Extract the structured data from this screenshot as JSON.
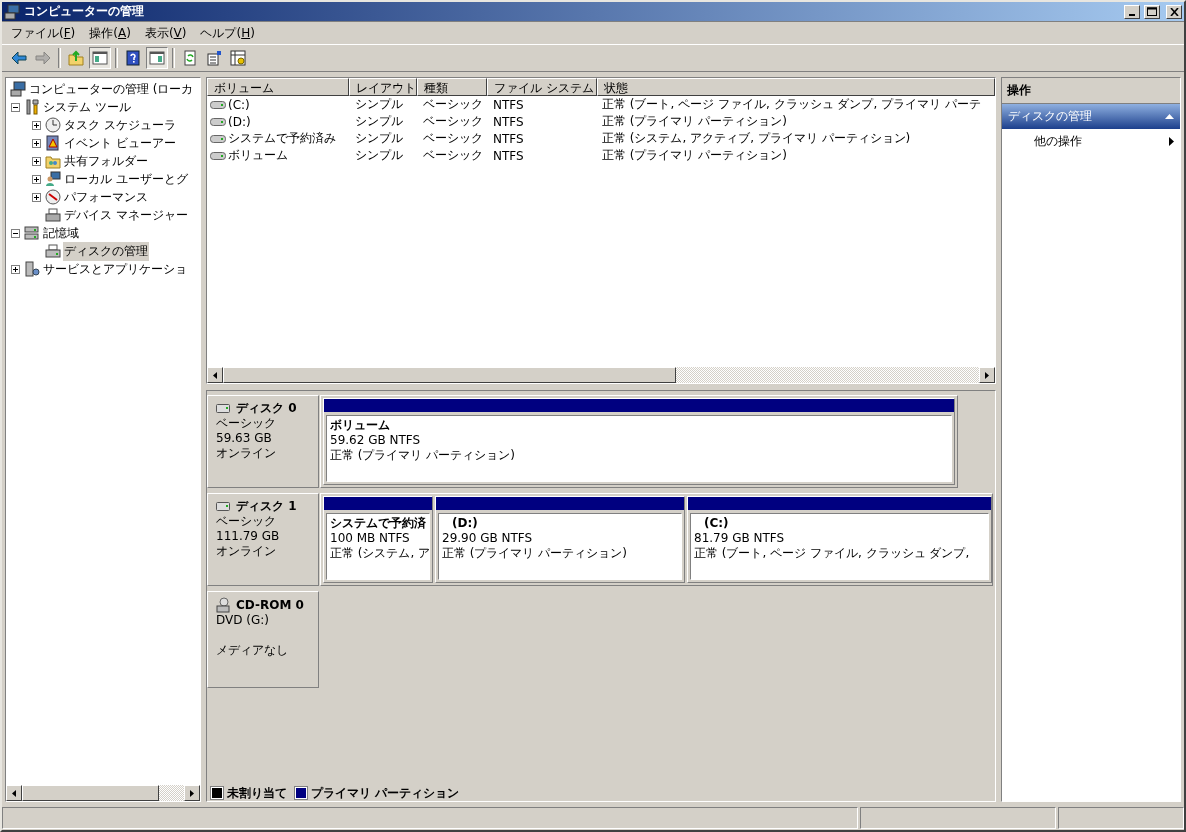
{
  "window": {
    "title": "コンピューターの管理"
  },
  "menu": [
    {
      "label": "ファイル(F)"
    },
    {
      "label": "操作(A)"
    },
    {
      "label": "表示(V)"
    },
    {
      "label": "ヘルプ(H)"
    }
  ],
  "toolbar": [
    {
      "kind": "back",
      "pressed": false,
      "disabled": false
    },
    {
      "kind": "forward",
      "pressed": false,
      "disabled": true
    },
    {
      "kind": "separator"
    },
    {
      "kind": "up",
      "pressed": false,
      "disabled": false
    },
    {
      "kind": "tree-pane",
      "pressed": true,
      "disabled": false
    },
    {
      "kind": "separator"
    },
    {
      "kind": "help",
      "pressed": false,
      "disabled": false
    },
    {
      "kind": "action-pane",
      "pressed": true,
      "disabled": false
    },
    {
      "kind": "separator"
    },
    {
      "kind": "refresh",
      "pressed": false,
      "disabled": false
    },
    {
      "kind": "properties",
      "pressed": false,
      "disabled": false
    },
    {
      "kind": "settings",
      "pressed": false,
      "disabled": false
    }
  ],
  "tree": {
    "label": "コンピューターの管理 (ローカ",
    "selected": false,
    "children": [
      {
        "label": "システム ツール",
        "expanded": true,
        "selected": false,
        "children": [
          {
            "label": "タスク スケジューラ",
            "expanded": false,
            "selected": false
          },
          {
            "label": "イベント ビューアー",
            "expanded": false,
            "selected": false
          },
          {
            "label": "共有フォルダー",
            "expanded": false,
            "selected": false
          },
          {
            "label": "ローカル ユーザーとグ",
            "expanded": false,
            "selected": false
          },
          {
            "label": "パフォーマンス",
            "expanded": false,
            "selected": false
          },
          {
            "label": "デバイス マネージャー",
            "selected": false
          }
        ]
      },
      {
        "label": "記憶域",
        "expanded": true,
        "selected": false,
        "children": [
          {
            "label": "ディスクの管理",
            "selected": true
          }
        ]
      },
      {
        "label": "サービスとアプリケーショ",
        "expanded": false,
        "selected": false
      }
    ]
  },
  "volumes": {
    "columns": [
      "ボリューム",
      "レイアウト",
      "種類",
      "ファイル システム",
      "状態"
    ],
    "rows": [
      [
        "(C:)",
        "シンプル",
        "ベーシック",
        "NTFS",
        "正常 (ブート, ページ ファイル, クラッシュ ダンプ, プライマリ パーテ"
      ],
      [
        "(D:)",
        "シンプル",
        "ベーシック",
        "NTFS",
        "正常 (プライマリ パーティション)"
      ],
      [
        "システムで予約済み",
        "シンプル",
        "ベーシック",
        "NTFS",
        "正常 (システム, アクティブ, プライマリ パーティション)"
      ],
      [
        "ボリューム",
        "シンプル",
        "ベーシック",
        "NTFS",
        "正常 (プライマリ パーティション)"
      ]
    ]
  },
  "disks": [
    {
      "kind": "disk",
      "name": "ディスク 0",
      "type": "ベーシック",
      "size": "59.63 GB",
      "status": "オンライン",
      "partitions": [
        {
          "name": "ボリューム",
          "size": "59.62 GB NTFS",
          "status": "正常 (プライマリ パーティション)",
          "color": "#000080"
        }
      ]
    },
    {
      "kind": "disk",
      "name": "ディスク 1",
      "type": "ベーシック",
      "size": "111.79 GB",
      "status": "オンライン",
      "partitions": [
        {
          "name": "システムで予約済",
          "size": "100 MB NTFS",
          "status": "正常 (システム, ア",
          "color": "#000080"
        },
        {
          "name": "(D:)",
          "size": "29.90 GB NTFS",
          "status": "正常 (プライマリ パーティション)",
          "color": "#000080"
        },
        {
          "name": "(C:)",
          "size": "81.79 GB NTFS",
          "status": "正常 (ブート, ページ ファイル, クラッシュ ダンプ,",
          "color": "#000080"
        }
      ]
    },
    {
      "kind": "cdrom",
      "name": "CD-ROM 0",
      "type": "DVD (G:)",
      "status": "メディアなし"
    }
  ],
  "legend": [
    {
      "label": "未割り当て",
      "color": "#000000"
    },
    {
      "label": "プライマリ パーティション",
      "color": "#000080"
    }
  ],
  "actions": {
    "title": "操作",
    "sections": [
      {
        "label": "ディスクの管理",
        "expanded": true,
        "items": [
          {
            "label": "他の操作",
            "submenu": true
          }
        ]
      }
    ]
  }
}
